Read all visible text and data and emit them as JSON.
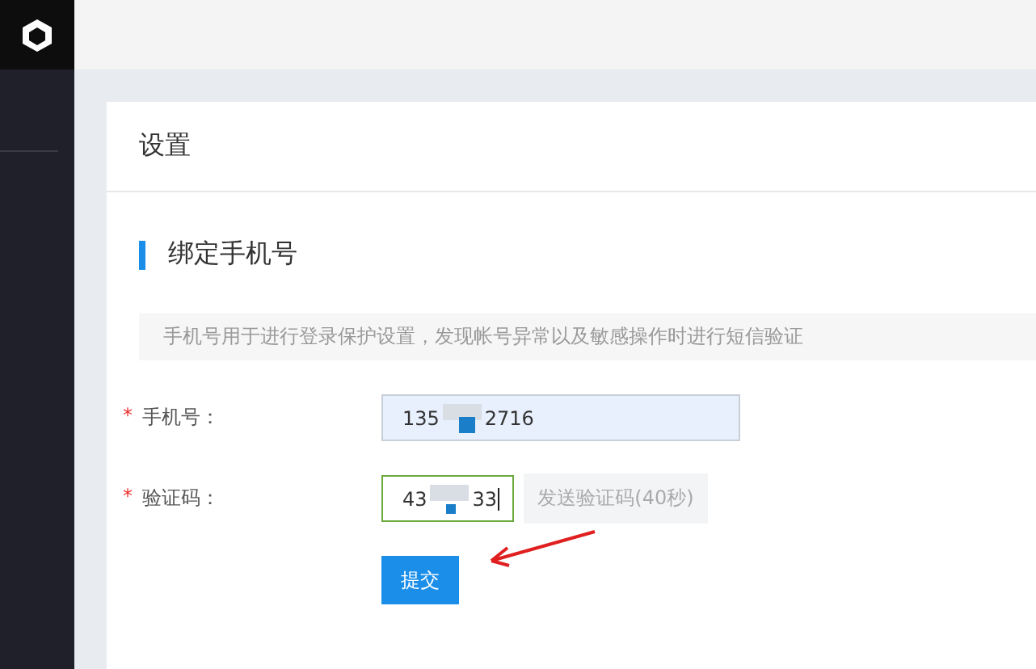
{
  "card": {
    "title": "设置"
  },
  "section": {
    "title": "绑定手机号"
  },
  "notice": "手机号用于进行登录保护设置，发现帐号异常以及敏感操作时进行短信验证",
  "fields": [
    {
      "kind": "phone",
      "required_mark": "*",
      "label": "手机号：",
      "value_parts": [
        "135",
        "2716"
      ],
      "focused": false
    },
    {
      "kind": "code",
      "required_mark": "*",
      "label": "验证码：",
      "value_parts": [
        "43",
        "33"
      ],
      "focused": true,
      "send_button": {
        "label": "发送验证码(40秒)",
        "disabled": true
      }
    }
  ],
  "submit": {
    "label": "提交"
  }
}
